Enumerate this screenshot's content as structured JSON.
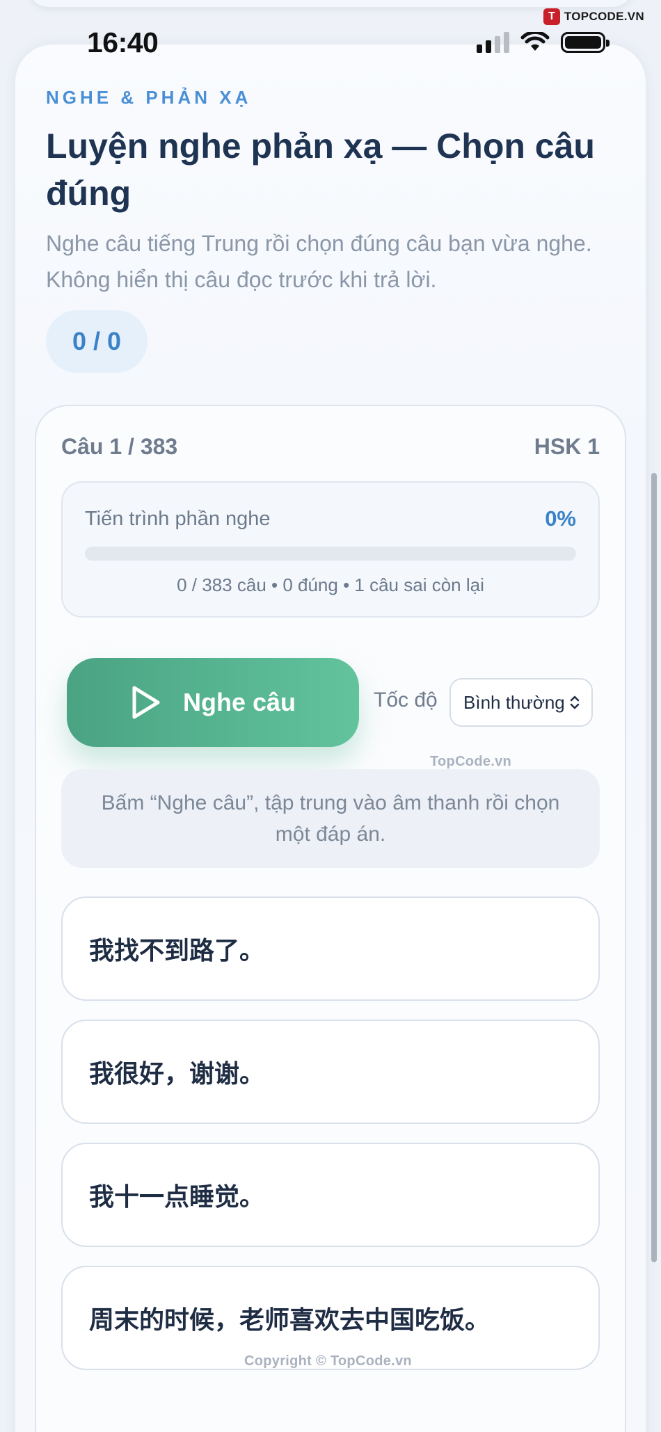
{
  "status_bar": {
    "time": "16:40"
  },
  "brand": {
    "mark": "T",
    "name": "TOPCODE.VN"
  },
  "header": {
    "eyebrow": "NGHE & PHẢN XẠ",
    "title": "Luyện nghe phản xạ — Chọn câu đúng",
    "subtitle": "Nghe câu tiếng Trung rồi chọn đúng câu bạn vừa nghe. Không hiển thị câu đọc trước khi trả lời.",
    "score": "0 / 0"
  },
  "question": {
    "counter": "Câu 1 / 383",
    "level": "HSK 1"
  },
  "progress": {
    "label": "Tiến trình phần nghe",
    "percent_text": "0%",
    "fraction": 0,
    "stats": "0 / 383 câu • 0 đúng • 1 câu sai còn lại"
  },
  "controls": {
    "listen_label": "Nghe câu",
    "speed_label": "Tốc độ",
    "speed_value": "Bình thường"
  },
  "hint": "Bấm “Nghe câu”, tập trung vào âm thanh rồi chọn một đáp án.",
  "options": [
    "我找不到路了。",
    "我很好，谢谢。",
    "我十一点睡觉。",
    "周末的时候，老师喜欢去中国吃饭。"
  ],
  "watermarks": {
    "center": "TopCode.vn",
    "copyright": "Copyright © TopCode.vn"
  },
  "colors": {
    "accent_blue": "#4a8fd6",
    "listen_green": "#4aa383",
    "title_navy": "#1f3452"
  }
}
